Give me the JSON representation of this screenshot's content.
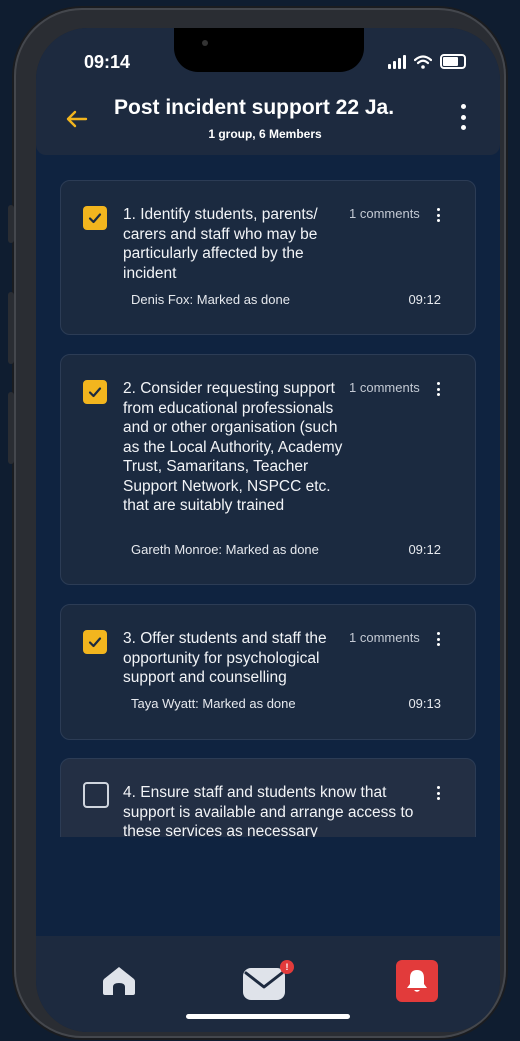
{
  "status_bar": {
    "time": "09:14"
  },
  "header": {
    "title": "Post incident support 22 Ja.",
    "subtitle": "1 group, 6 Members"
  },
  "tasks": [
    {
      "text": "1. Identify students, parents/ carers and staff who may be particularly affected by the incident",
      "comments": "1 comments",
      "done_by": "Denis Fox: Marked as done",
      "time": "09:12",
      "checked": true
    },
    {
      "text": "2. Consider requesting support from educational professionals and or other organisation (such as the Local Authority, Academy Trust, Samaritans, Teacher Support Network, NSPCC etc. that are suitably trained",
      "comments": "1 comments",
      "done_by": "Gareth Monroe: Marked as done",
      "time": "09:12",
      "checked": true
    },
    {
      "text": "3. Offer students and staff the opportunity for psychological support and counselling",
      "comments": "1 comments",
      "done_by": "Taya Wyatt: Marked as done",
      "time": "09:13",
      "checked": true
    },
    {
      "text": "4. Ensure staff and students know that support is available and arrange access to these services as necessary",
      "checked": false
    }
  ],
  "bottom_nav": {
    "mail_badge": "!"
  },
  "colors": {
    "accent": "#f2b51e",
    "alert": "#e23b3b",
    "card_bg": "#1b2a40",
    "screen_bg": "#0f2340"
  }
}
